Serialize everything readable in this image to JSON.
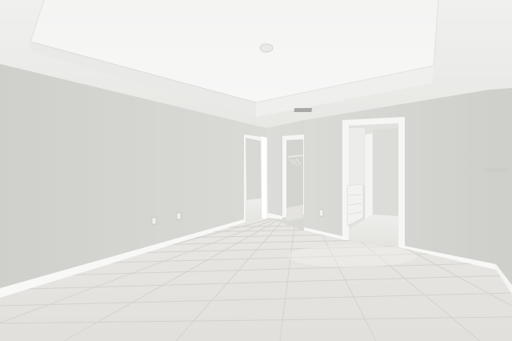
{
  "scene": {
    "subject": "empty bedroom",
    "colors": {
      "ceiling": "#f2f2f0",
      "tray_ceiling": "#f7f7f6",
      "wall_left": "#d6d6d2",
      "wall_back": "#dcdcd9",
      "wall_right": "#d9d9d6",
      "floor": "#e6e4e0",
      "grout": "#d2d0cb",
      "baseboard": "#fafaf9",
      "door_trim": "#f5f5f4"
    }
  }
}
